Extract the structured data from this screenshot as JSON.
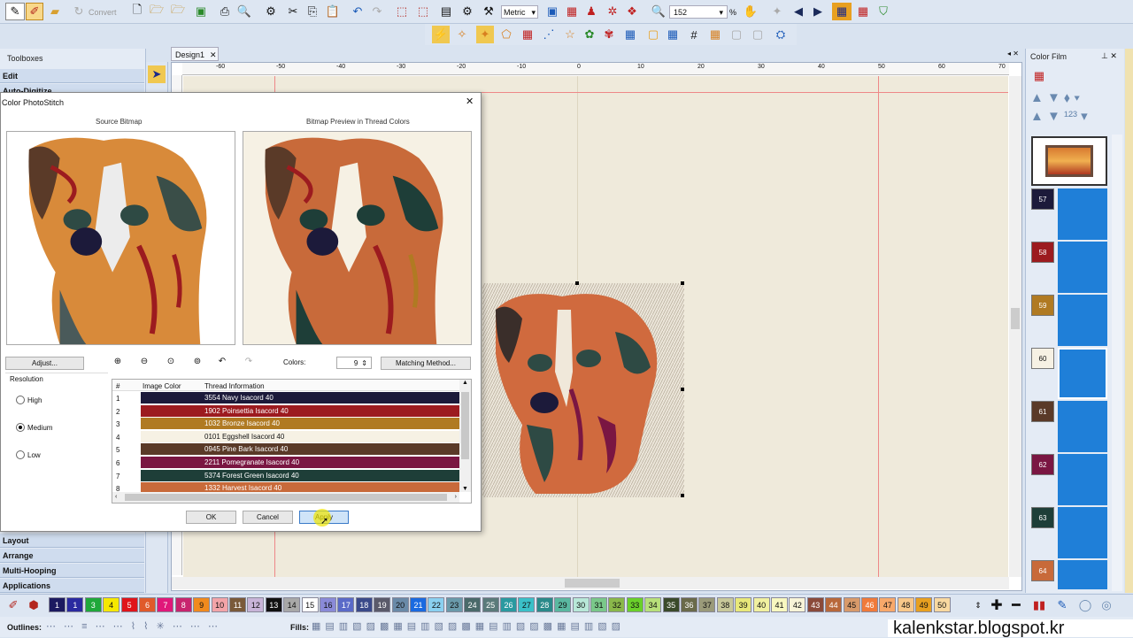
{
  "toolbar": {
    "convert_label": "Convert",
    "units": "Metric",
    "zoom_value": "152",
    "zoom_unit": "%"
  },
  "tabs": {
    "design_tab": "Design1"
  },
  "ruler": {
    "marks": [
      "-60",
      "-50",
      "-40",
      "-30",
      "-20",
      "-10",
      "0",
      "10",
      "20",
      "30",
      "40",
      "50",
      "60",
      "70"
    ]
  },
  "left_panel": {
    "title": "Toolboxes",
    "top_items": [
      "Edit",
      "Auto-Digitize"
    ],
    "bottom_items": [
      "Layout",
      "Arrange",
      "Multi-Hooping",
      "Applications"
    ]
  },
  "dialog": {
    "title": "Color PhotoStitch",
    "source_label": "Source Bitmap",
    "preview_label": "Bitmap Preview in Thread Colors",
    "adjust_button": "Adjust...",
    "colors_label": "Colors:",
    "colors_value": "9",
    "matching_button": "Matching Method...",
    "resolution_label": "Resolution",
    "resolution_options": [
      "High",
      "Medium",
      "Low"
    ],
    "resolution_selected": "Medium",
    "table_headers": {
      "num": "#",
      "image_color": "Image Color",
      "thread_info": "Thread Information"
    },
    "rows": [
      {
        "num": "1",
        "info": "3554 Navy Isacord 40",
        "color": "#1c1a3a",
        "text": "#ffffff"
      },
      {
        "num": "2",
        "info": "1902 Poinsettia Isacord 40",
        "color": "#9c1b1f",
        "text": "#ffffff"
      },
      {
        "num": "3",
        "info": "1032 Bronze Isacord 40",
        "color": "#b07a22",
        "text": "#ffffff"
      },
      {
        "num": "4",
        "info": "0101 Eggshell Isacord 40",
        "color": "#f6f1e4",
        "text": "#111111"
      },
      {
        "num": "5",
        "info": "0945 Pine Bark Isacord 40",
        "color": "#5a3a28",
        "text": "#ffffff"
      },
      {
        "num": "6",
        "info": "2211 Pomegranate Isacord 40",
        "color": "#7a1642",
        "text": "#ffffff"
      },
      {
        "num": "7",
        "info": "5374 Forest Green Isacord 40",
        "color": "#1e3e38",
        "text": "#ffffff"
      },
      {
        "num": "8",
        "info": "1332 Harvest Isacord 40",
        "color": "#c86a3a",
        "text": "#ffffff"
      }
    ],
    "ok_button": "OK",
    "cancel_button": "Cancel",
    "apply_button": "Apply"
  },
  "color_film": {
    "title": "Color Film",
    "items": [
      {
        "num": "57",
        "color": "#1c1a3a"
      },
      {
        "num": "58",
        "color": "#9c1b1f"
      },
      {
        "num": "59",
        "color": "#b07a22"
      },
      {
        "num": "60",
        "color": "#f6f1e4"
      },
      {
        "num": "61",
        "color": "#5a3a28"
      },
      {
        "num": "62",
        "color": "#7a1642"
      },
      {
        "num": "63",
        "color": "#1e3e38"
      },
      {
        "num": "64",
        "color": "#c86a3a"
      }
    ]
  },
  "palette": {
    "swatches": [
      {
        "n": "1",
        "c": "#1c1a60"
      },
      {
        "n": "1",
        "c": "#2a2aa0"
      },
      {
        "n": "3",
        "c": "#1fa83a"
      },
      {
        "n": "4",
        "c": "#f5e800"
      },
      {
        "n": "5",
        "c": "#e0141a"
      },
      {
        "n": "6",
        "c": "#e05a2a"
      },
      {
        "n": "7",
        "c": "#e0187a"
      },
      {
        "n": "8",
        "c": "#c8246e"
      },
      {
        "n": "9",
        "c": "#f08a1e"
      },
      {
        "n": "10",
        "c": "#f2a4a8"
      },
      {
        "n": "11",
        "c": "#7a5a3a"
      },
      {
        "n": "12",
        "c": "#c8b4d8"
      },
      {
        "n": "13",
        "c": "#111111"
      },
      {
        "n": "14",
        "c": "#a8a8a8"
      },
      {
        "n": "15",
        "c": "#ffffff"
      },
      {
        "n": "16",
        "c": "#8a8ad8"
      },
      {
        "n": "17",
        "c": "#5a6ac8"
      },
      {
        "n": "18",
        "c": "#3a4a8a"
      },
      {
        "n": "19",
        "c": "#5a5a6a"
      },
      {
        "n": "20",
        "c": "#6a8aa8"
      },
      {
        "n": "21",
        "c": "#1a6ae0"
      },
      {
        "n": "22",
        "c": "#8ad0f0"
      },
      {
        "n": "23",
        "c": "#6a9aaa"
      },
      {
        "n": "24",
        "c": "#4a6a6a"
      },
      {
        "n": "25",
        "c": "#5a7a7a"
      },
      {
        "n": "26",
        "c": "#2a9aa0"
      },
      {
        "n": "27",
        "c": "#3ac0c8"
      },
      {
        "n": "28",
        "c": "#2a8a8a"
      },
      {
        "n": "29",
        "c": "#5ab8a0"
      },
      {
        "n": "30",
        "c": "#b8e8d8"
      },
      {
        "n": "31",
        "c": "#7ac88a"
      },
      {
        "n": "32",
        "c": "#8ab84a"
      },
      {
        "n": "33",
        "c": "#6ad02a"
      },
      {
        "n": "34",
        "c": "#b8e07a"
      },
      {
        "n": "35",
        "c": "#3a4a2a"
      },
      {
        "n": "36",
        "c": "#6a6a4a"
      },
      {
        "n": "37",
        "c": "#9a9a7a"
      },
      {
        "n": "38",
        "c": "#c8c89a"
      },
      {
        "n": "39",
        "c": "#e8e87a"
      },
      {
        "n": "40",
        "c": "#f0f0a0"
      },
      {
        "n": "41",
        "c": "#f8f8c0"
      },
      {
        "n": "42",
        "c": "#f8f4d8"
      },
      {
        "n": "43",
        "c": "#8a4a3a"
      },
      {
        "n": "44",
        "c": "#b8683a"
      },
      {
        "n": "45",
        "c": "#d89a6a"
      },
      {
        "n": "46",
        "c": "#f07a3a"
      },
      {
        "n": "47",
        "c": "#f8a86a"
      },
      {
        "n": "48",
        "c": "#f8c88a"
      },
      {
        "n": "49",
        "c": "#e8a020"
      },
      {
        "n": "50",
        "c": "#f8d8a0"
      }
    ]
  },
  "bottom_bar": {
    "outlines_label": "Outlines:",
    "fills_label": "Fills:"
  },
  "watermark": "kalenkstar.blogspot.kr"
}
